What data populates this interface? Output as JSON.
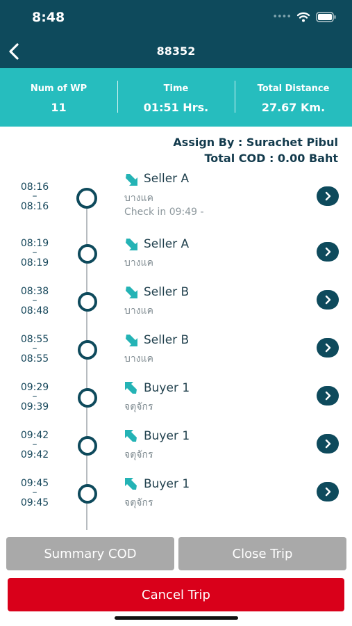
{
  "status": {
    "time": "8:48"
  },
  "header": {
    "title": "88352"
  },
  "stats": [
    {
      "label": "Num of WP",
      "value": "11"
    },
    {
      "label": "Time",
      "value": "01:51 Hrs."
    },
    {
      "label": "Total Distance",
      "value": "27.67 Km."
    }
  ],
  "assign": {
    "by": "Assign By : Surachet Pibul",
    "cod": "Total COD : 0.00 Baht"
  },
  "waypoints": [
    {
      "start": "08:16",
      "end": "08:16",
      "type": "pickup",
      "name": "Seller A",
      "area": "บางแค",
      "checkin": "Check in 09:49 -"
    },
    {
      "start": "08:19",
      "end": "08:19",
      "type": "pickup",
      "name": "Seller A",
      "area": "บางแค"
    },
    {
      "start": "08:38",
      "end": "08:48",
      "type": "pickup",
      "name": "Seller B",
      "area": "บางแค"
    },
    {
      "start": "08:55",
      "end": "08:55",
      "type": "pickup",
      "name": "Seller B",
      "area": "บางแค"
    },
    {
      "start": "09:29",
      "end": "09:39",
      "type": "delivery",
      "name": "Buyer 1",
      "area": "จตุจักร"
    },
    {
      "start": "09:42",
      "end": "09:42",
      "type": "delivery",
      "name": "Buyer 1",
      "area": "จตุจักร"
    },
    {
      "start": "09:45",
      "end": "09:45",
      "type": "delivery",
      "name": "Buyer 1",
      "area": "จตุจักร"
    }
  ],
  "buttons": {
    "summary_cod": "Summary COD",
    "close_trip": "Close Trip",
    "cancel_trip": "Cancel Trip"
  },
  "colors": {
    "header": "#0e4a5c",
    "stats_bar": "#26bdbe",
    "arrow": "#24b3b5",
    "cancel": "#d9001a",
    "disabled": "#a9a9a9"
  },
  "icons": {
    "back": "chevron-left-icon",
    "pickup": "arrow-down-right-icon",
    "delivery": "arrow-up-left-icon",
    "go": "chevron-right-icon"
  }
}
